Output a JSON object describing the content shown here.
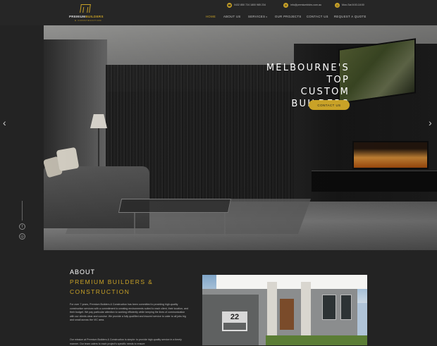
{
  "brand": {
    "name_white": "PREMIUM",
    "name_gold": "BUILDERS",
    "sub": "& CONSTRUCTION"
  },
  "contact": {
    "phone_icon": "phone-icon",
    "phones": "0432 850 724   1800 985 234",
    "email_icon": "mail-icon",
    "email": "info@premiumbldrs.com.au",
    "hours_icon": "clock-icon",
    "hours": "Mon-Sat 8:00-18:00"
  },
  "nav": {
    "home": "HOME",
    "about": "ABOUT US",
    "services": "SERVICES",
    "projects": "OUR PROJECTS",
    "contact": "CONTACT US",
    "quote": "REQUEST A QUOTE"
  },
  "hero": {
    "title_line1": "MELBOURNE'S TOP",
    "title_line2": "CUSTOM BUILDERS",
    "cta": "CONTACT US",
    "prev": "‹",
    "next": "›"
  },
  "social": {
    "facebook": "f",
    "instagram": "◎"
  },
  "about": {
    "kicker": "ABOUT",
    "title_line1": "PREMIUM BUILDERS &",
    "title_line2": "CONSTRUCTION",
    "para1": "For over 7 years, Premium Builders & Construction has been committed to providing high-quality construction services with a commitment to creating environments suited to each client, their location, and their budget. We pay particular attention to working efficiently while keeping the lines of communication with our clients clear and concise. We provide a fully qualified and insured service to cater to all jobs big and small across the VIC area.",
    "para2": "Our mission at Premium Builders & Construction is simple: to provide high-quality service in a timely manner. Our team caters to each project's specific needs to ensure"
  },
  "house_image": {
    "number": "22"
  },
  "colors": {
    "accent": "#c9a227",
    "background": "#232323"
  }
}
